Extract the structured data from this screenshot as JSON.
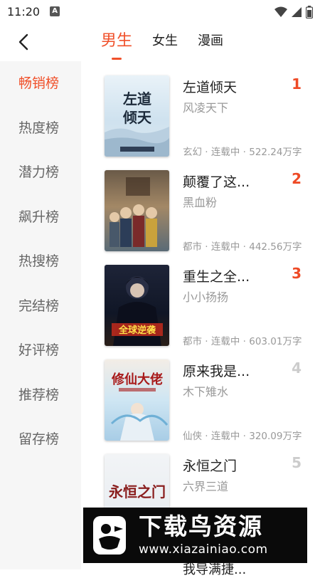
{
  "status_bar": {
    "time": "11:20",
    "notification_icon": "a-icon",
    "icons": [
      "wifi-icon",
      "signal-icon",
      "battery-icon"
    ]
  },
  "header": {
    "back_icon": "chevron-left-icon",
    "tabs": [
      {
        "label": "男生",
        "active": true
      },
      {
        "label": "女生",
        "active": false
      },
      {
        "label": "漫画",
        "active": false
      }
    ]
  },
  "sidebar": {
    "items": [
      {
        "label": "畅销榜",
        "active": true
      },
      {
        "label": "热度榜"
      },
      {
        "label": "潜力榜"
      },
      {
        "label": "飙升榜"
      },
      {
        "label": "热搜榜"
      },
      {
        "label": "完结榜"
      },
      {
        "label": "好评榜"
      },
      {
        "label": "推荐榜"
      },
      {
        "label": "留存榜"
      }
    ]
  },
  "books": [
    {
      "rank": "1",
      "title": "左道倾天",
      "author": "风凌天下",
      "meta": "玄幻 · 连载中 · 522.24万字",
      "cover_text": "左道倾天"
    },
    {
      "rank": "2",
      "title": "颠覆了这...",
      "author": "黑血粉",
      "meta": "都市 · 连载中 · 442.56万字",
      "cover_text": ""
    },
    {
      "rank": "3",
      "title": "重生之全...",
      "author": "小小扬扬",
      "meta": "都市 · 连载中 · 603.01万字",
      "cover_text": "全球逆袭"
    },
    {
      "rank": "4",
      "title": "原来我是...",
      "author": "木下雉水",
      "meta": "仙侠 · 连载中 · 320.09万字",
      "cover_text": "修仙大佬"
    },
    {
      "rank": "5",
      "title": "永恒之门",
      "author": "六界三道",
      "meta": "",
      "cover_text": "永恒之门"
    }
  ],
  "peek": {
    "title": "我导满捷..."
  },
  "watermark": {
    "main": "下载鸟资源",
    "url": "www.xiazainiao.com"
  },
  "colors": {
    "accent": "#f0502a",
    "rank_top": "#ee4a26",
    "rank_normal": "#cccccc",
    "sidebar_bg": "#f6f6f6"
  }
}
